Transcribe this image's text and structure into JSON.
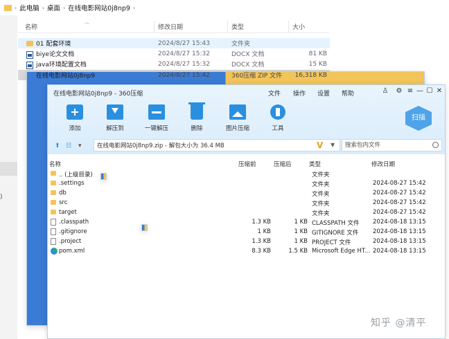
{
  "explorer": {
    "breadcrumb": [
      "此电脑",
      "桌面",
      "在线电影网站0j8np9"
    ],
    "columns": {
      "name": "名称",
      "modified": "修改日期",
      "type": "类型",
      "size": "大小"
    },
    "rows": [
      {
        "name": "01 配套环境",
        "modified": "2024/8/27 15:43",
        "type": "文件夹",
        "size": "",
        "icon": "folder-icon"
      },
      {
        "name": "biye论文文档",
        "modified": "2024/8/27 15:32",
        "type": "DOCX 文档",
        "size": "81 KB",
        "icon": "docx-icon"
      },
      {
        "name": "java环境配置文档",
        "modified": "2024/8/27 15:32",
        "type": "DOCX 文档",
        "size": "15 KB",
        "icon": "docx-icon"
      },
      {
        "name": "在线电影网站0j8np9",
        "modified": "2024/8/27 15:42",
        "type": "360压缩 ZIP 文件",
        "size": "16,318 KB",
        "icon": "zip-icon"
      }
    ]
  },
  "zip_window": {
    "title": "在线电影网站0j8np9 - 360压缩",
    "menu": [
      "文件",
      "操作",
      "设置",
      "帮助"
    ],
    "toolbar": [
      {
        "label": "添加",
        "icon": "add-icon"
      },
      {
        "label": "解压到",
        "icon": "extract-icon"
      },
      {
        "label": "一键解压",
        "icon": "one-click-extract-icon"
      },
      {
        "label": "删除",
        "icon": "delete-icon"
      },
      {
        "label": "图片压缩",
        "icon": "image-compress-icon"
      },
      {
        "label": "工具",
        "icon": "tools-icon"
      }
    ],
    "scan_label": "扫描",
    "path": "在线电影网站0j8np9.zip - 解包大小为 36.4 MB",
    "search_placeholder": "搜索包内文件",
    "columns": {
      "name": "名称",
      "compressed": "压缩前",
      "packed": "压缩后",
      "type": "类型",
      "modified": "修改日期"
    },
    "rows": [
      {
        "name": ".. (上级目录)",
        "compressed": "",
        "packed": "",
        "type": "文件夹",
        "modified": "",
        "icon": "folder-icon"
      },
      {
        "name": ".settings",
        "compressed": "",
        "packed": "",
        "type": "文件夹",
        "modified": "2024-08-27 15:42",
        "icon": "folder-icon"
      },
      {
        "name": "db",
        "compressed": "",
        "packed": "",
        "type": "文件夹",
        "modified": "2024-08-27 15:42",
        "icon": "folder-icon"
      },
      {
        "name": "src",
        "compressed": "",
        "packed": "",
        "type": "文件夹",
        "modified": "2024-08-27 15:42",
        "icon": "folder-icon"
      },
      {
        "name": "target",
        "compressed": "",
        "packed": "",
        "type": "文件夹",
        "modified": "2024-08-27 15:42",
        "icon": "folder-icon"
      },
      {
        "name": ".classpath",
        "compressed": "1.3 KB",
        "packed": "1 KB",
        "type": "CLASSPATH 文件",
        "modified": "2024-08-18 13:15",
        "icon": "file-icon"
      },
      {
        "name": ".gitignore",
        "compressed": "1 KB",
        "packed": "1 KB",
        "type": "GITIGNORE 文件",
        "modified": "2024-08-18 13:15",
        "icon": "file-icon"
      },
      {
        "name": ".project",
        "compressed": "1.3 KB",
        "packed": "1 KB",
        "type": "PROJECT 文件",
        "modified": "2024-08-18 13:15",
        "icon": "file-icon"
      },
      {
        "name": "pom.xml",
        "compressed": "8.3 KB",
        "packed": "1.5 KB",
        "type": "Microsoft Edge HT...",
        "modified": "2024-08-18 13:15",
        "icon": "edge-icon"
      }
    ]
  },
  "watermark": "知乎 @清平"
}
